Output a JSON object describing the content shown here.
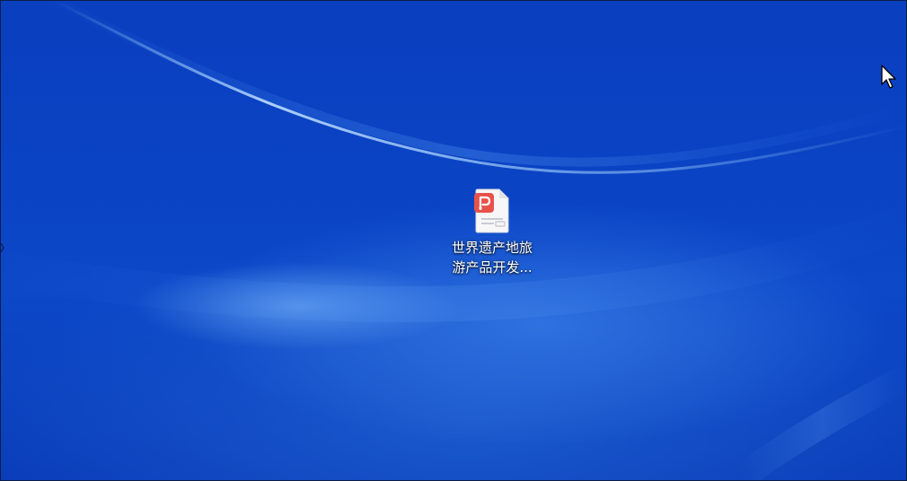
{
  "desktop": {
    "icons": [
      {
        "icon_type": "wps-presentation-file-icon",
        "label_line1": "世界遗产地旅",
        "label_line2": "游产品开发...",
        "accent_color": "#e8524a"
      }
    ]
  },
  "cursor": {
    "icon": "arrow-pointer-icon"
  }
}
